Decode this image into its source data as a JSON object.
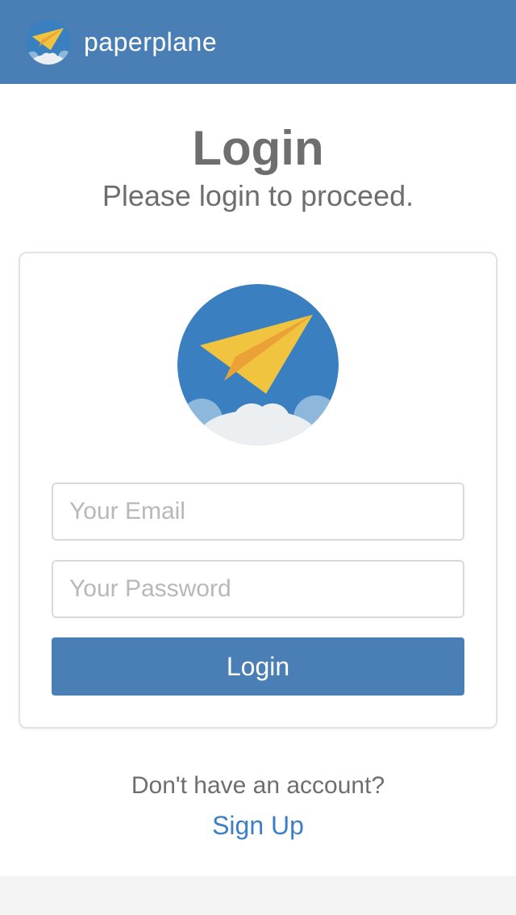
{
  "header": {
    "brand": "paperplane",
    "logo_icon": "paper-plane-logo-icon",
    "background_color": "#4a7fb5"
  },
  "login": {
    "title": "Login",
    "subtitle": "Please login to proceed.",
    "logo_icon": "paper-plane-logo-icon",
    "email_placeholder": "Your Email",
    "email_value": "",
    "password_placeholder": "Your Password",
    "password_value": "",
    "submit_label": "Login",
    "button_color": "#4a7fb5"
  },
  "signup": {
    "prompt": "Don't have an account?",
    "link_label": "Sign Up",
    "link_color": "#3d7fc7"
  }
}
